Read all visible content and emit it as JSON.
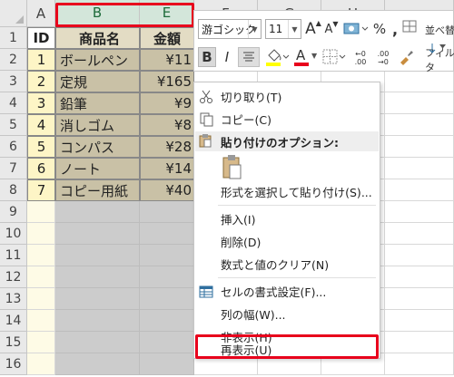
{
  "columns": [
    {
      "letter": "A",
      "selected": false
    },
    {
      "letter": "B",
      "selected": true
    },
    {
      "letter": "E",
      "selected": true
    },
    {
      "letter": "F",
      "selected": false
    },
    {
      "letter": "G",
      "selected": false
    },
    {
      "letter": "H",
      "selected": false
    }
  ],
  "rows": [
    "1",
    "2",
    "3",
    "4",
    "5",
    "6",
    "7",
    "8",
    "9",
    "10",
    "11",
    "12",
    "13",
    "14",
    "15",
    "16"
  ],
  "table": {
    "header": {
      "id": "ID",
      "name": "商品名",
      "price": "金額"
    },
    "items": [
      {
        "id": "1",
        "name": "ボールペン",
        "price": "¥11"
      },
      {
        "id": "2",
        "name": "定規",
        "price": "¥165"
      },
      {
        "id": "3",
        "name": "鉛筆",
        "price": "¥9"
      },
      {
        "id": "4",
        "name": "消しゴム",
        "price": "¥8"
      },
      {
        "id": "5",
        "name": "コンパス",
        "price": "¥28"
      },
      {
        "id": "6",
        "name": "ノート",
        "price": "¥14"
      },
      {
        "id": "7",
        "name": "コピー用紙",
        "price": "¥40"
      }
    ]
  },
  "mini_toolbar": {
    "font_name": "游ゴシック",
    "font_size": "11",
    "grow": "A",
    "shrink": "A",
    "percent": "%",
    "comma": ",",
    "bold": "B",
    "italic": "I",
    "font_color_letter": "A",
    "inc_decimal_top": "←0",
    "inc_decimal_bottom": ".00",
    "dec_decimal_top": ".00",
    "dec_decimal_bottom": "→0",
    "sort_filter_line1": "並べ替",
    "sort_filter_line2": "フィルタ"
  },
  "context_menu": {
    "cut": "切り取り(T)",
    "copy": "コピー(C)",
    "paste_options": "貼り付けのオプション:",
    "paste_special": "形式を選択して貼り付け(S)...",
    "insert": "挿入(I)",
    "delete": "削除(D)",
    "clear": "数式と値のクリア(N)",
    "format_cells": "セルの書式設定(F)...",
    "col_width": "列の幅(W)...",
    "hide": "非表示(H)",
    "unhide": "再表示(U)"
  },
  "colors": {
    "selection_fill": "#c9c1a6",
    "selection_empty": "#cccccc",
    "id_fill": "#fdf5c6",
    "highlight": "#e8001c"
  }
}
